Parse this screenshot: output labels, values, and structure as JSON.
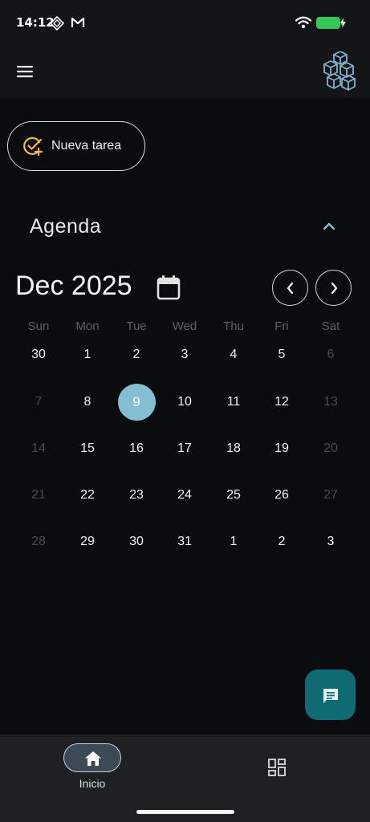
{
  "status_bar": {
    "time": "14:12"
  },
  "header": {
    "menu_icon": "hamburger-menu-icon",
    "logo_icon": "cubes-logo-icon"
  },
  "actions": {
    "new_task_label": "Nueva tarea",
    "new_task_icon": "check-plus-icon"
  },
  "agenda": {
    "title": "Agenda",
    "month_label": "Dec 2025",
    "weekdays": [
      "Sun",
      "Mon",
      "Tue",
      "Wed",
      "Thu",
      "Fri",
      "Sat"
    ],
    "weeks": [
      [
        "30",
        "1",
        "2",
        "3",
        "4",
        "5",
        "6"
      ],
      [
        "7",
        "8",
        "9",
        "10",
        "11",
        "12",
        "13"
      ],
      [
        "14",
        "15",
        "16",
        "17",
        "18",
        "19",
        "20"
      ],
      [
        "21",
        "22",
        "23",
        "24",
        "25",
        "26",
        "27"
      ],
      [
        "28",
        "29",
        "30",
        "31",
        "1",
        "2",
        "3"
      ]
    ],
    "selected_day": "9"
  },
  "bottom_nav": {
    "home_label": "Inicio"
  },
  "colors": {
    "accent": "#84bed3",
    "fab": "#0f6a73",
    "check_icon": "#f0b84a",
    "logo": "#7fb3cc"
  }
}
